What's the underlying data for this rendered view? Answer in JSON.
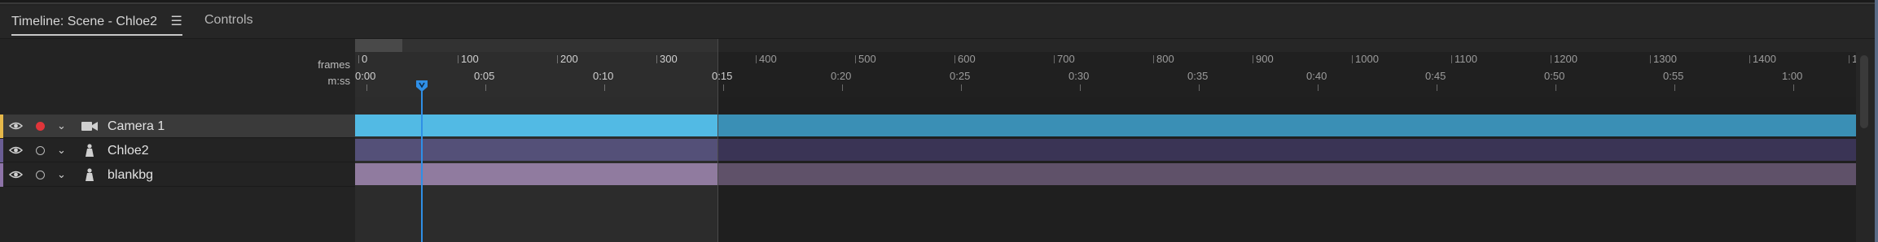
{
  "tabs": [
    {
      "label": "Timeline: Scene - Chloe2",
      "active": true
    },
    {
      "label": "Controls",
      "active": false
    }
  ],
  "menu_icon": "hamburger-menu-icon",
  "ruler": {
    "frames_label": "frames",
    "time_label": "m:ss",
    "frame_ticks": [
      "0",
      "100",
      "200",
      "300",
      "400",
      "500",
      "600",
      "700",
      "800",
      "900",
      "1000",
      "1100",
      "1200",
      "1300",
      "1400",
      "1"
    ],
    "time_ticks": [
      "0:00",
      "0:05",
      "0:10",
      "0:15",
      "0:20",
      "0:25",
      "0:30",
      "0:35",
      "0:40",
      "0:45",
      "0:50",
      "0:55",
      "1:00"
    ],
    "playhead_frame": 66,
    "work_area_end_frame": 365
  },
  "layers": [
    {
      "name": "Camera 1",
      "icon": "camera-icon",
      "recording": true,
      "selected": true,
      "color": "#e6b84a",
      "bar_color": "#3a8fb5",
      "bar_bright": "#48b6e3"
    },
    {
      "name": "Chloe2",
      "icon": "puppet-icon",
      "recording": false,
      "selected": false,
      "color": "#6a5d94",
      "bar_color": "#3a3455",
      "bar_bright": "#4a4670"
    },
    {
      "name": "blankbg",
      "icon": "puppet-icon",
      "recording": false,
      "selected": false,
      "color": "#8d73a8",
      "bar_color": "#5f5169",
      "bar_bright": "#8a7399"
    }
  ],
  "colors": {
    "playhead": "#2f8fe6",
    "accent": "#48b6e3"
  }
}
